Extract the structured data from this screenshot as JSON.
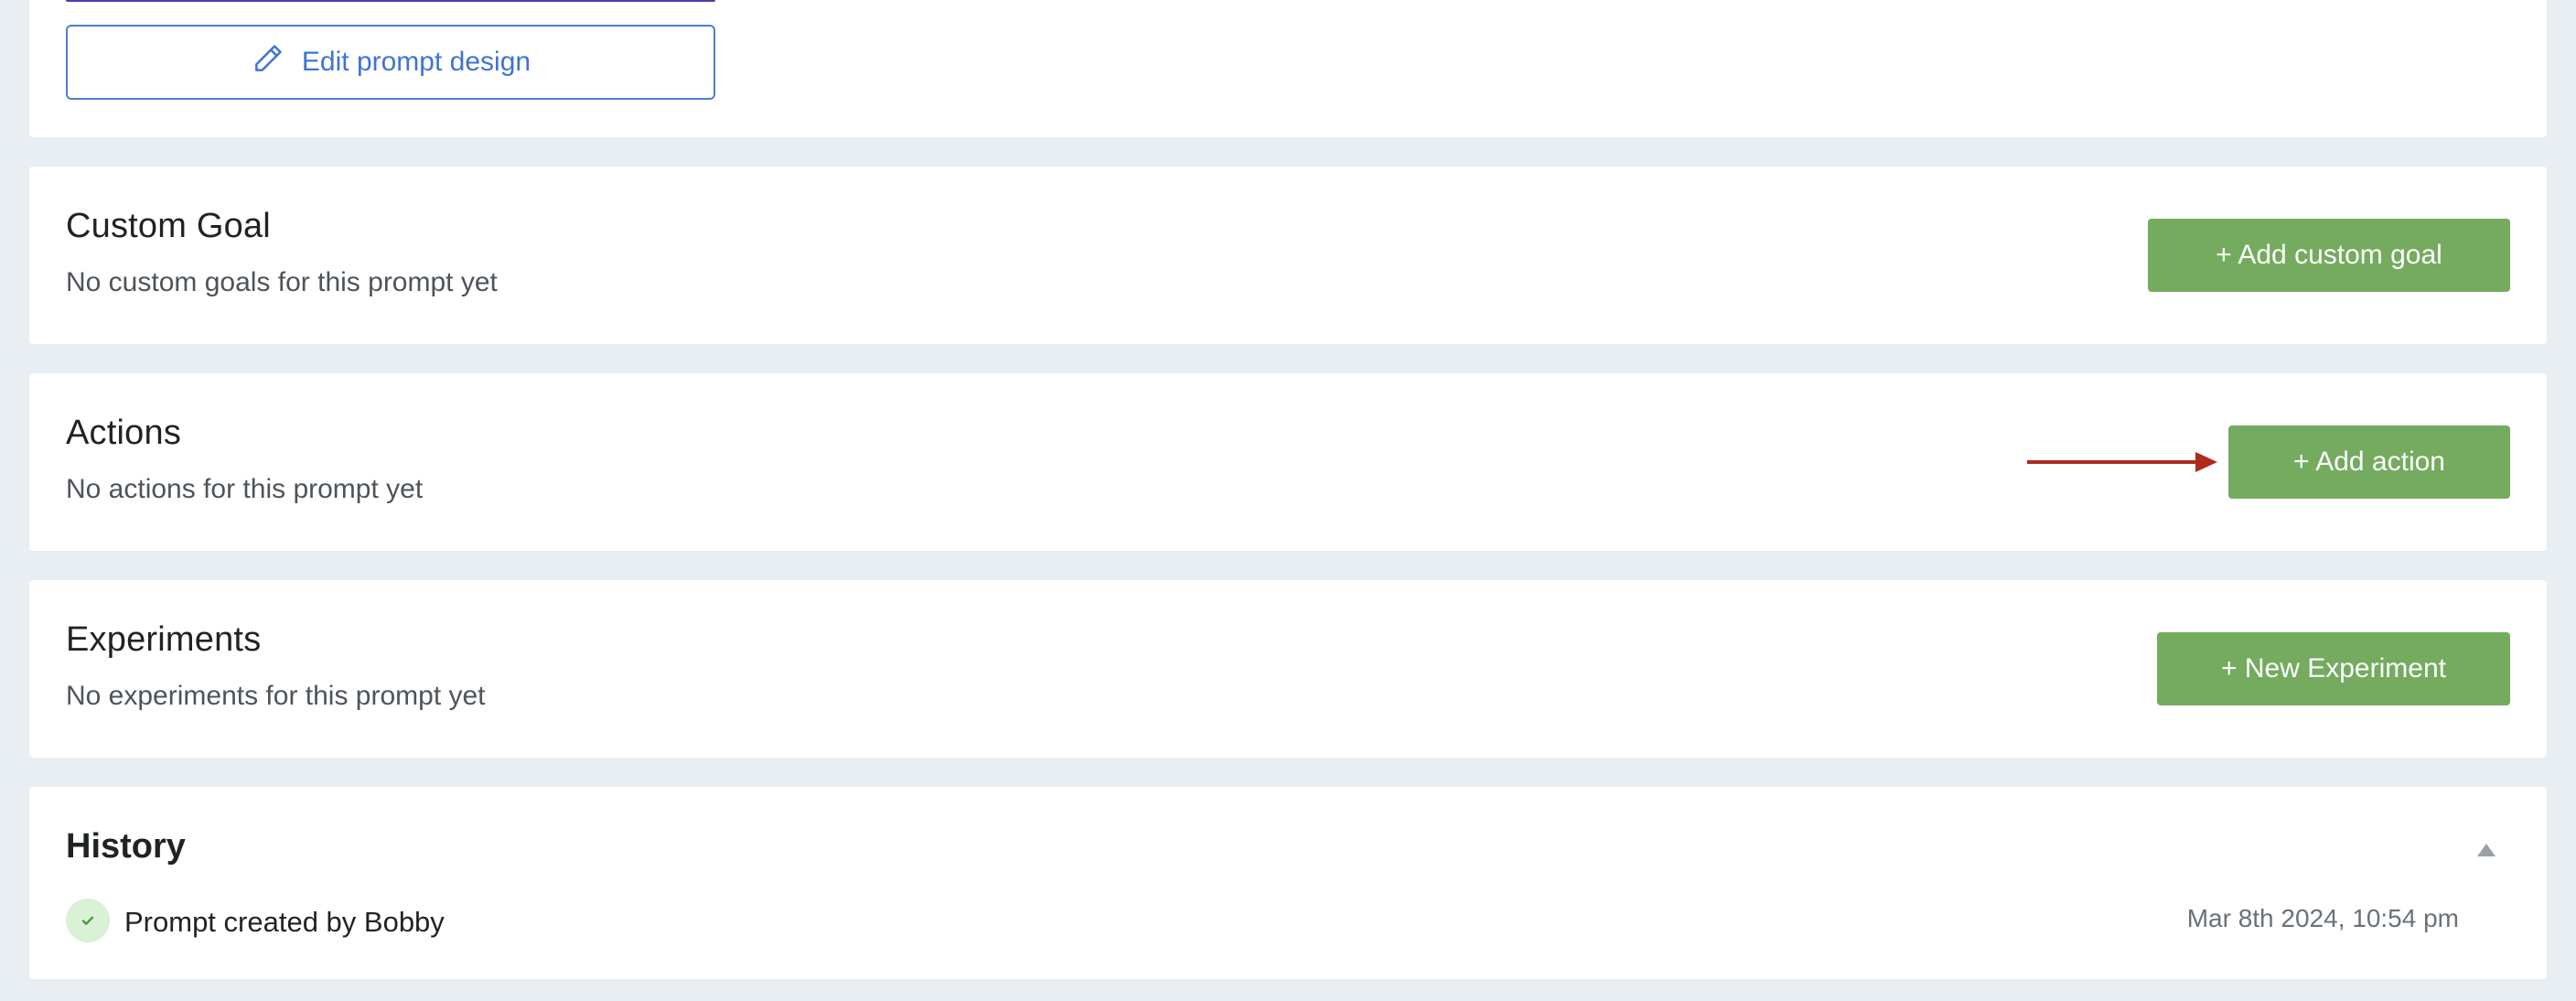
{
  "top": {
    "edit_button_label": "Edit prompt design"
  },
  "custom_goal": {
    "title": "Custom Goal",
    "empty_text": "No custom goals for this prompt yet",
    "button_label": "+ Add custom goal"
  },
  "actions": {
    "title": "Actions",
    "empty_text": "No actions for this prompt yet",
    "button_label": "+ Add action"
  },
  "experiments": {
    "title": "Experiments",
    "empty_text": "No experiments for this prompt yet",
    "button_label": "+ New Experiment"
  },
  "history": {
    "title": "History",
    "entries": [
      {
        "text": "Prompt created by Bobby",
        "timestamp": "Mar 8th 2024, 10:54 pm",
        "status_icon": "check-icon"
      }
    ]
  },
  "colors": {
    "primary_green": "#74ab5f",
    "link_blue": "#3f74d1",
    "annotation_red": "#b02a1e",
    "background": "#e9eef3"
  },
  "icons": {
    "edit": "pencil-icon",
    "collapse": "triangle-up-icon",
    "history_status": "check-icon"
  }
}
